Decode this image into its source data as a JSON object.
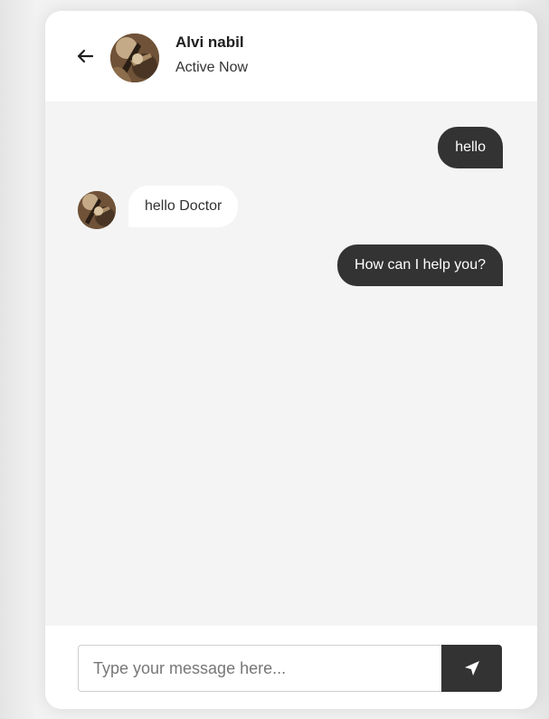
{
  "header": {
    "name": "Alvi nabil",
    "status": "Active Now",
    "back_icon": "arrow-left-icon",
    "avatar_icon": "user-avatar"
  },
  "messages": [
    {
      "direction": "outgoing",
      "text": "hello"
    },
    {
      "direction": "incoming",
      "text": "hello Doctor"
    },
    {
      "direction": "outgoing",
      "text": "How can I help you?"
    }
  ],
  "composer": {
    "placeholder": "Type your message here...",
    "value": "",
    "send_icon": "paper-plane-icon"
  },
  "colors": {
    "accent": "#333333",
    "card_background": "#f4f4f4",
    "header_background": "#ffffff",
    "incoming_bubble": "#ffffff",
    "outgoing_bubble": "#333333"
  }
}
